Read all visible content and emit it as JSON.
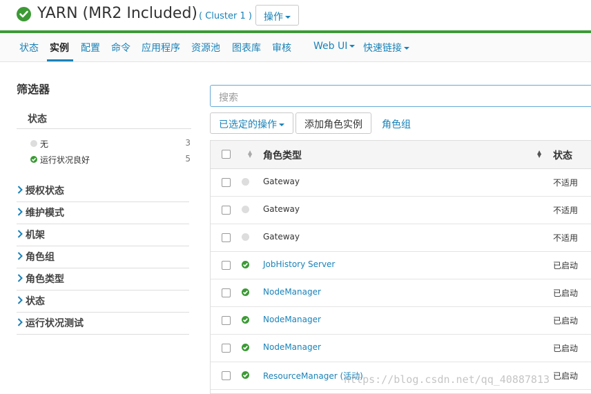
{
  "header": {
    "title": "YARN (MR2 Included)",
    "cluster": "( Cluster 1 )",
    "action_label": "操作"
  },
  "nav": {
    "items": [
      "状态",
      "实例",
      "配置",
      "命令",
      "应用程序",
      "资源池",
      "图表库",
      "审核"
    ],
    "webui": "Web UI",
    "quicklinks": "快速链接",
    "active": "实例"
  },
  "filters": {
    "title": "筛选器",
    "status_label": "状态",
    "status_rows": [
      {
        "label": "无",
        "count": "3"
      },
      {
        "label": "运行状况良好",
        "count": "5"
      }
    ],
    "sections": [
      "授权状态",
      "维护模式",
      "机架",
      "角色组",
      "角色类型",
      "状态",
      "运行状况测试"
    ]
  },
  "toolbar": {
    "search_placeholder": "搜索",
    "selected_actions": "已选定的操作",
    "add_role": "添加角色实例",
    "role_group": "角色组"
  },
  "table": {
    "col_role": "角色类型",
    "col_status": "状态",
    "rows": [
      {
        "role": "Gateway",
        "status": "不适用",
        "health": "none",
        "link": false
      },
      {
        "role": "Gateway",
        "status": "不适用",
        "health": "none",
        "link": false
      },
      {
        "role": "Gateway",
        "status": "不适用",
        "health": "none",
        "link": false
      },
      {
        "role": "JobHistory Server",
        "status": "已启动",
        "health": "good",
        "link": true
      },
      {
        "role": "NodeManager",
        "status": "已启动",
        "health": "good",
        "link": true
      },
      {
        "role": "NodeManager",
        "status": "已启动",
        "health": "good",
        "link": true
      },
      {
        "role": "NodeManager",
        "status": "已启动",
        "health": "good",
        "link": true
      },
      {
        "role": "ResourceManager (活动)",
        "status": "已启动",
        "health": "good",
        "link": true
      }
    ]
  },
  "watermark": "https://blog.csdn.net/qq_40887813",
  "colors": {
    "accent": "#1a82b8",
    "good": "#3c9a35",
    "none": "#dddddd"
  }
}
